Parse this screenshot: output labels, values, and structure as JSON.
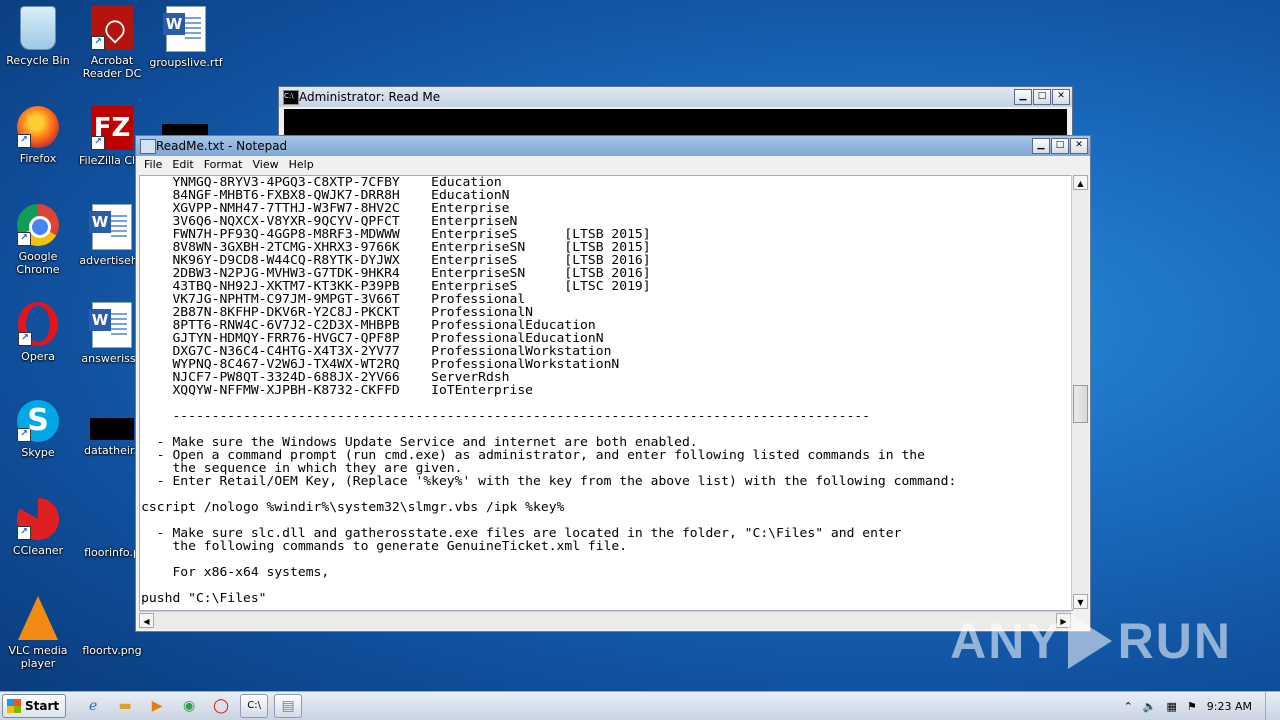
{
  "desktop": {
    "icons": [
      {
        "label": "Recycle Bin",
        "icon": "recycle-bin-icon"
      },
      {
        "label": "Acrobat Reader DC",
        "icon": "acrobat-icon"
      },
      {
        "label": "groupslive.rtf",
        "icon": "word-document-icon"
      },
      {
        "label": "Firefox",
        "icon": "firefox-icon"
      },
      {
        "label": "FileZilla Clie",
        "icon": "filezilla-icon"
      },
      {
        "label": "Google Chrome",
        "icon": "chrome-icon"
      },
      {
        "label": "advertisehe",
        "icon": "word-document-icon"
      },
      {
        "label": "Opera",
        "icon": "opera-icon"
      },
      {
        "label": "answerissu",
        "icon": "word-document-icon"
      },
      {
        "label": "Skype",
        "icon": "skype-icon"
      },
      {
        "label": "datatheir.j",
        "icon": "image-thumbnail-icon"
      },
      {
        "label": "CCleaner",
        "icon": "ccleaner-icon"
      },
      {
        "label": "floorinfo.p",
        "icon": "image-thumbnail-icon"
      },
      {
        "label": "VLC media player",
        "icon": "vlc-icon"
      },
      {
        "label": "floortv.png",
        "icon": "image-thumbnail-icon"
      }
    ]
  },
  "cmd_window": {
    "title": "Administrator:  Read Me"
  },
  "notepad": {
    "title": "ReadMe.txt - Notepad",
    "menu": [
      "File",
      "Edit",
      "Format",
      "View",
      "Help"
    ],
    "content": "    YNMGQ-8RYV3-4PGQ3-C8XTP-7CFBY    Education\n    84NGF-MHBT6-FXBX8-QWJK7-DRR8H    EducationN\n    XGVPP-NMH47-7TTHJ-W3FW7-8HV2C    Enterprise\n    3V6Q6-NQXCX-V8YXR-9QCYV-QPFCT    EnterpriseN\n    FWN7H-PF93Q-4GGP8-M8RF3-MDWWW    EnterpriseS      [LTSB 2015]\n    8V8WN-3GXBH-2TCMG-XHRX3-9766K    EnterpriseSN     [LTSB 2015]\n    NK96Y-D9CD8-W44CQ-R8YTK-DYJWX    EnterpriseS      [LTSB 2016]\n    2DBW3-N2PJG-MVHW3-G7TDK-9HKR4    EnterpriseSN     [LTSB 2016]\n    43TBQ-NH92J-XKTM7-KT3KK-P39PB    EnterpriseS      [LTSC 2019]\n    VK7JG-NPHTM-C97JM-9MPGT-3V66T    Professional\n    2B87N-8KFHP-DKV6R-Y2C8J-PKCKT    ProfessionalN\n    8PTT6-RNW4C-6V7J2-C2D3X-MHBPB    ProfessionalEducation\n    GJTYN-HDMQY-FRR76-HVGC7-QPF8P    ProfessionalEducationN\n    DXG7C-N36C4-C4HTG-X4T3X-2YV77    ProfessionalWorkstation\n    WYPNQ-8C467-V2W6J-TX4WX-WT2RQ    ProfessionalWorkstationN\n    NJCF7-PW8QT-3324D-688JX-2YV66    ServerRdsh\n    XQQYW-NFFMW-XJPBH-K8732-CKFFD    IoTEnterprise\n\n    -----------------------------------------------------------------------------------------\n\n  - Make sure the Windows Update Service and internet are both enabled.\n  - Open a command prompt (run cmd.exe) as administrator, and enter following listed commands in the\n    the sequence in which they are given.\n  - Enter Retail/OEM Key, (Replace '%key%' with the key from the above list) with the following command:\n\ncscript /nologo %windir%\\system32\\slmgr.vbs /ipk %key%\n\n  - Make sure slc.dll and gatherosstate.exe files are located in the folder, \"C:\\Files\" and enter\n    the following commands to generate GenuineTicket.xml file.\n\n    For x86-x64 systems,\n\npushd \"C:\\Files\""
  },
  "watermark": {
    "left": "ANY",
    "right": "RUN"
  },
  "taskbar": {
    "start_label": "Start",
    "clock": "9:23 AM"
  }
}
